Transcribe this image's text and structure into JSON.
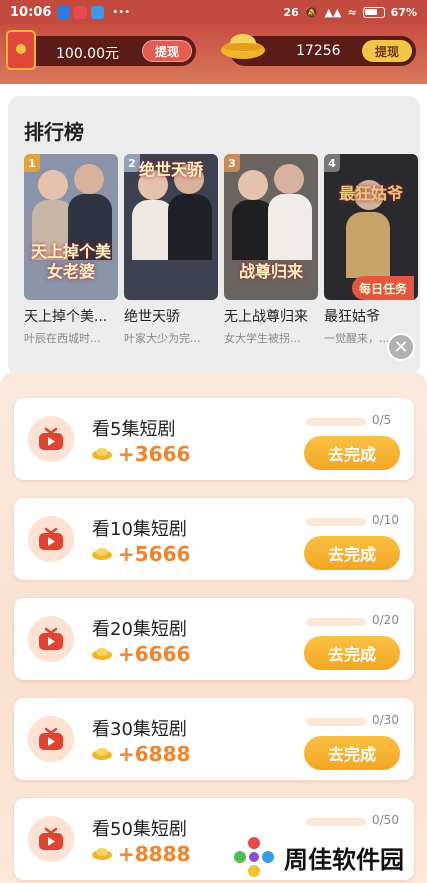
{
  "status_bar": {
    "time": "10:06",
    "more": "•••",
    "signal_label": "26",
    "battery_percent": "67%",
    "app_icon_colors": [
      "#2f7be5",
      "#e84a4a",
      "#3a9ae8"
    ]
  },
  "header": {
    "cash_amount": "100.00元",
    "cash_withdraw_label": "提现",
    "coin_amount": "17256",
    "coin_withdraw_label": "提现"
  },
  "ranking": {
    "title": "排行榜",
    "daily_task_label": "每日任务",
    "items": [
      {
        "rank": "1",
        "title": "天上掉个美...",
        "subtitle": "叶辰在西城时...",
        "poster_text": "天上掉个美女老婆",
        "badge_color": "#e2a23a",
        "poster_bg": "#8a93a7"
      },
      {
        "rank": "2",
        "title": "绝世天骄",
        "subtitle": "叶家大少为完...",
        "poster_text": "绝世天骄",
        "badge_color": "#8fa3b8",
        "poster_bg": "#3d4150"
      },
      {
        "rank": "3",
        "title": "无上战尊归来",
        "subtitle": "女大学生被拐...",
        "poster_text": "战尊归来",
        "badge_color": "#c98a56",
        "poster_bg": "#6a6460"
      },
      {
        "rank": "4",
        "title": "最狂姑爷",
        "subtitle": "一觉醒来，...",
        "poster_text": "最狂姑爷",
        "badge_color": "#777777",
        "poster_bg": "#2a2a2e"
      }
    ]
  },
  "tasks": [
    {
      "name": "看5集短剧",
      "reward": "+3666",
      "progress_text": "0/5",
      "progress": 0,
      "button": "去完成"
    },
    {
      "name": "看10集短剧",
      "reward": "+5666",
      "progress_text": "0/10",
      "progress": 0,
      "button": "去完成"
    },
    {
      "name": "看20集短剧",
      "reward": "+6666",
      "progress_text": "0/20",
      "progress": 0,
      "button": "去完成"
    },
    {
      "name": "看30集短剧",
      "reward": "+6888",
      "progress_text": "0/30",
      "progress": 0,
      "button": "去完成"
    },
    {
      "name": "看50集短剧",
      "reward": "+8888",
      "progress_text": "0/50",
      "progress": 0,
      "button": "去完成"
    }
  ],
  "watermark": {
    "text": "周佳软件园"
  },
  "colors": {
    "accent": "#f4a523",
    "reward": "#f3832b",
    "header": "#c84e40"
  }
}
